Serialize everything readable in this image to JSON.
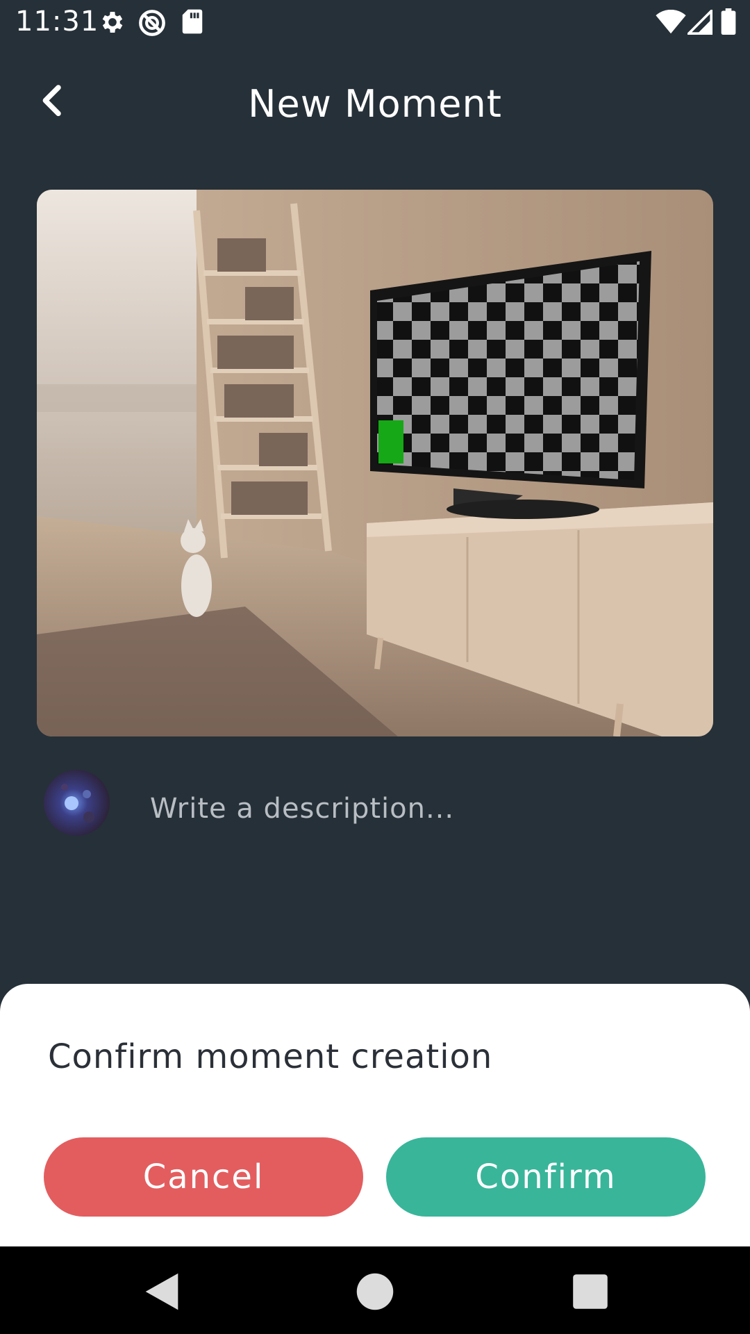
{
  "status_bar": {
    "time": "11:31",
    "left_icons": [
      "gear-icon",
      "do-not-disturb-icon",
      "sd-card-icon"
    ],
    "right_icons": [
      "wifi-icon",
      "signal-icon",
      "battery-icon"
    ]
  },
  "header": {
    "back_icon": "chevron-left-icon",
    "title": "New Moment"
  },
  "photo": {
    "description": "room-scene-image"
  },
  "description": {
    "avatar": "user-avatar",
    "placeholder": "Write a description...",
    "value": ""
  },
  "dialog": {
    "title": "Confirm moment creation",
    "cancel_label": "Cancel",
    "confirm_label": "Confirm",
    "cancel_color": "#e35d5f",
    "confirm_color": "#39b59a"
  },
  "nav_bar": {
    "icons": [
      "back-triangle-icon",
      "home-circle-icon",
      "recents-square-icon"
    ]
  },
  "colors": {
    "background": "#263038",
    "sheet": "#ffffff"
  }
}
